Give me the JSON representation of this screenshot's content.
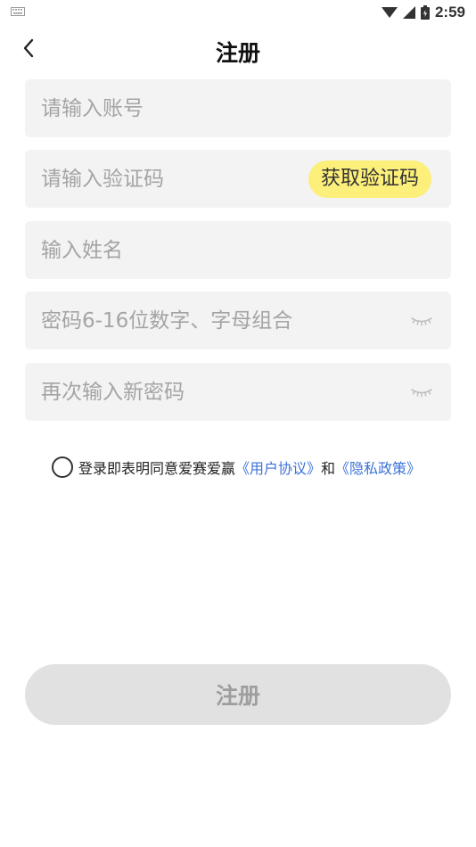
{
  "status_bar": {
    "time": "2:59"
  },
  "header": {
    "title": "注册"
  },
  "form": {
    "account_placeholder": "请输入账号",
    "code_placeholder": "请输入验证码",
    "get_code_label": "获取验证码",
    "name_placeholder": "输入姓名",
    "password_placeholder": "密码6-16位数字、字母组合",
    "confirm_placeholder": "再次输入新密码"
  },
  "agreement": {
    "prefix": "登录即表明同意爱赛爱赢",
    "user_agreement": "《用户协议》",
    "and": "和",
    "privacy_policy": "《隐私政策》"
  },
  "submit": {
    "label": "注册"
  },
  "colors": {
    "accent_yellow": "#fcef7a",
    "link_blue": "#3d72d6",
    "field_bg": "#f3f3f3",
    "button_disabled": "#e1e1e1"
  }
}
